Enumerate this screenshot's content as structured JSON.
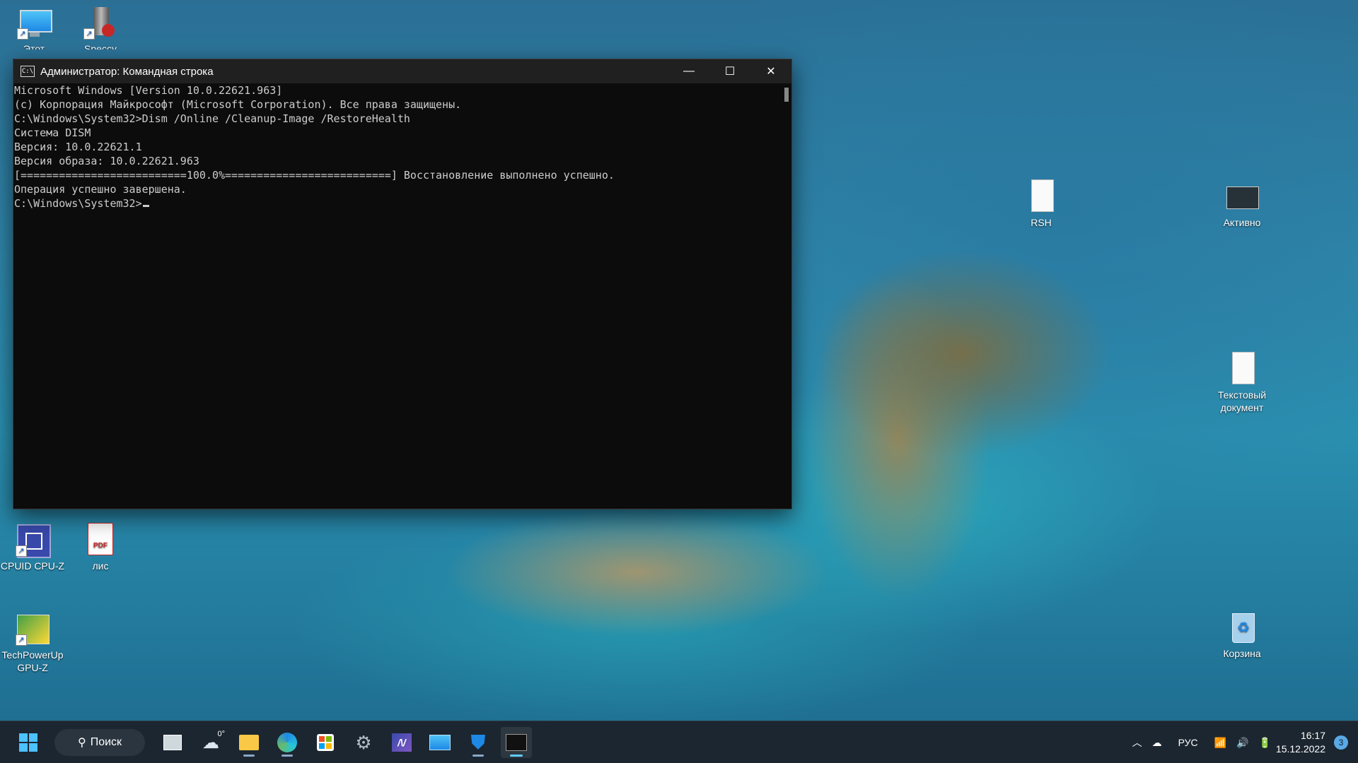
{
  "desktop": {
    "icons": [
      {
        "label": "Этот компьютер",
        "icon": "monitor-icon"
      },
      {
        "label": "Speccy",
        "icon": "speccy-icon"
      },
      {
        "label": "CPUID CPU-Z",
        "icon": "cpu-z-icon"
      },
      {
        "label": "лис",
        "icon": "pdf-icon",
        "badge": "PDF"
      },
      {
        "label": "TechPowerUp GPU-Z",
        "icon": "gpu-z-icon"
      },
      {
        "label": "RSH",
        "icon": "text-file-icon"
      },
      {
        "label": "Активно",
        "icon": "screenshot-file-icon"
      },
      {
        "label": "Текстовый документ",
        "icon": "text-file-icon"
      },
      {
        "label": "Корзина",
        "icon": "recycle-bin-icon"
      }
    ]
  },
  "window": {
    "title": "Администратор: Командная строка",
    "icon_text": "C:\\",
    "controls": {
      "minimize": "—",
      "maximize": "☐",
      "close": "✕"
    },
    "lines": [
      "Microsoft Windows [Version 10.0.22621.963]",
      "(c) Корпорация Майкрософт (Microsoft Corporation). Все права защищены.",
      "",
      "C:\\Windows\\System32>Dism /Online /Cleanup-Image /RestoreHealth",
      "",
      "Система DISM",
      "Версия: 10.0.22621.1",
      "",
      "Версия образа: 10.0.22621.963",
      "",
      "[==========================100.0%==========================] Восстановление выполнено успешно.",
      "Операция успешно завершена.",
      "",
      "C:\\Windows\\System32>"
    ]
  },
  "taskbar": {
    "search_label": "Поиск",
    "weather_temp": "0°",
    "apps": [
      "task-view-icon",
      "weather-icon",
      "file-explorer-icon",
      "edge-icon",
      "store-icon",
      "settings-icon",
      "monitor-tool-icon",
      "rdp-icon",
      "security-icon",
      "terminal-icon"
    ],
    "language": "РУС",
    "time": "16:17",
    "date": "15.12.2022",
    "notifications": "3"
  }
}
